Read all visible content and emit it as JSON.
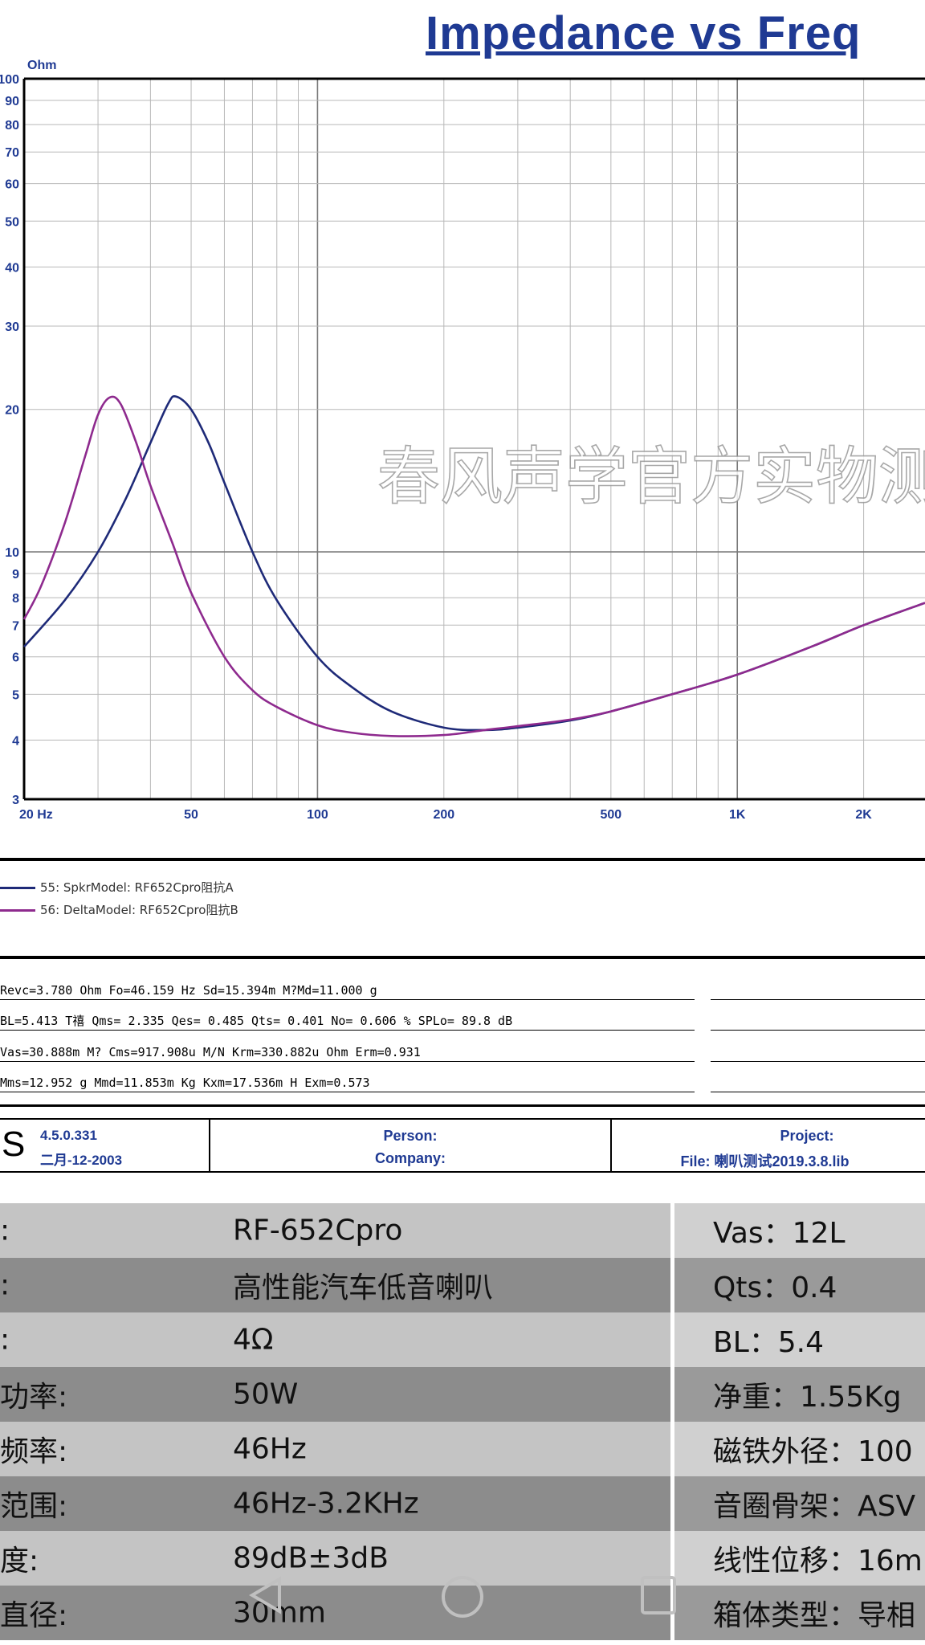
{
  "title": "Impedance vs Freq",
  "chart_data": {
    "type": "line",
    "x_scale": "log",
    "y_scale": "log",
    "xlim": [
      20,
      2800
    ],
    "ylim": [
      3,
      100
    ],
    "y_unit": "Ohm",
    "x_tick_labels": [
      {
        "value": 20,
        "label": "20 Hz"
      },
      {
        "value": 50,
        "label": "50"
      },
      {
        "value": 100,
        "label": "100"
      },
      {
        "value": 200,
        "label": "200"
      },
      {
        "value": 500,
        "label": "500"
      },
      {
        "value": 1000,
        "label": "1K"
      },
      {
        "value": 2000,
        "label": "2K"
      }
    ],
    "y_tick_labels": [
      {
        "value": 100,
        "label": "100"
      },
      {
        "value": 90,
        "label": "90"
      },
      {
        "value": 80,
        "label": "80"
      },
      {
        "value": 70,
        "label": "70"
      },
      {
        "value": 60,
        "label": "60"
      },
      {
        "value": 50,
        "label": "50"
      },
      {
        "value": 40,
        "label": "40"
      },
      {
        "value": 30,
        "label": "30"
      },
      {
        "value": 20,
        "label": "20"
      },
      {
        "value": 10,
        "label": "10"
      },
      {
        "value": 9,
        "label": "9"
      },
      {
        "value": 8,
        "label": "8"
      },
      {
        "value": 7,
        "label": "7"
      },
      {
        "value": 6,
        "label": "6"
      },
      {
        "value": 5,
        "label": "5"
      },
      {
        "value": 4,
        "label": "4"
      },
      {
        "value": 3,
        "label": "3"
      }
    ],
    "grid": true,
    "series": [
      {
        "name": "55: SpkrModel: RF652Cpro阻抗A",
        "color": "#1e2a78",
        "x": [
          20,
          25,
          30,
          35,
          40,
          44,
          46,
          50,
          55,
          60,
          70,
          80,
          100,
          120,
          150,
          200,
          250,
          300,
          400,
          500,
          700,
          1000,
          1500,
          2000,
          2800
        ],
        "y": [
          6.3,
          7.9,
          10.0,
          13.0,
          17.0,
          20.5,
          21.3,
          20.0,
          17.0,
          14.0,
          10.0,
          7.9,
          6.0,
          5.2,
          4.6,
          4.25,
          4.2,
          4.25,
          4.4,
          4.6,
          5.0,
          5.5,
          6.3,
          7.0,
          7.8
        ]
      },
      {
        "name": "56: DeltaModel: RF652Cpro阻抗B",
        "color": "#8e2a8e",
        "x": [
          20,
          22,
          25,
          28,
          30,
          32,
          34,
          37,
          40,
          45,
          50,
          60,
          70,
          80,
          100,
          120,
          150,
          200,
          250,
          300,
          400,
          500,
          700,
          1000,
          1500,
          2000,
          2800
        ],
        "y": [
          7.2,
          8.5,
          11.5,
          16.0,
          19.5,
          21.2,
          20.5,
          17.0,
          13.8,
          10.5,
          8.2,
          6.0,
          5.1,
          4.7,
          4.3,
          4.15,
          4.08,
          4.1,
          4.2,
          4.28,
          4.42,
          4.6,
          5.0,
          5.5,
          6.3,
          7.0,
          7.8
        ]
      }
    ]
  },
  "watermark": "春风声学官方实物测试",
  "legend": [
    {
      "label": "55: SpkrModel: RF652Cpro阻抗A",
      "color": "#1e2a78"
    },
    {
      "label": "56: DeltaModel: RF652Cpro阻抗B",
      "color": "#8e2a8e"
    }
  ],
  "params": [
    "Revc=3.780 Ohm  Fo=46.159 Hz  Sd=15.394m M?Md=11.000 g",
    "BL=5.413 T禧  Qms= 2.335  Qes= 0.485  Qts= 0.401  No= 0.606 %  SPLo= 89.8 dB",
    "Vas=30.888m M? Cms=917.908u M/N  Krm=330.882u Ohm  Erm=0.931",
    "Mms=12.952 g  Mmd=11.853m Kg  Kxm=17.536m H  Exm=0.573"
  ],
  "info": {
    "logo": "S",
    "version": "4.5.0.331",
    "date": "二月-12-2003",
    "person": "Person:",
    "company": "Company:",
    "project": "Project:",
    "file": "File: 喇叭测试2019.3.8.lib"
  },
  "specs": [
    {
      "label": ":",
      "value": "RF-652Cpro",
      "right": "Vas：12L"
    },
    {
      "label": ":",
      "value": "高性能汽车低音喇叭",
      "right": "Qts：0.4"
    },
    {
      "label": ":",
      "value": "4Ω",
      "right": "BL：5.4"
    },
    {
      "label": "功率:",
      "value": "50W",
      "right": "净重：1.55Kg"
    },
    {
      "label": "频率:",
      "value": "46Hz",
      "right": "磁铁外径：100"
    },
    {
      "label": "范围:",
      "value": "46Hz-3.2KHz",
      "right": "音圈骨架：ASV"
    },
    {
      "label": "度:",
      "value": "89dB±3dB",
      "right": "线性位移：16m"
    },
    {
      "label": "直径:",
      "value": "30mm",
      "right": "箱体类型：导相"
    }
  ]
}
